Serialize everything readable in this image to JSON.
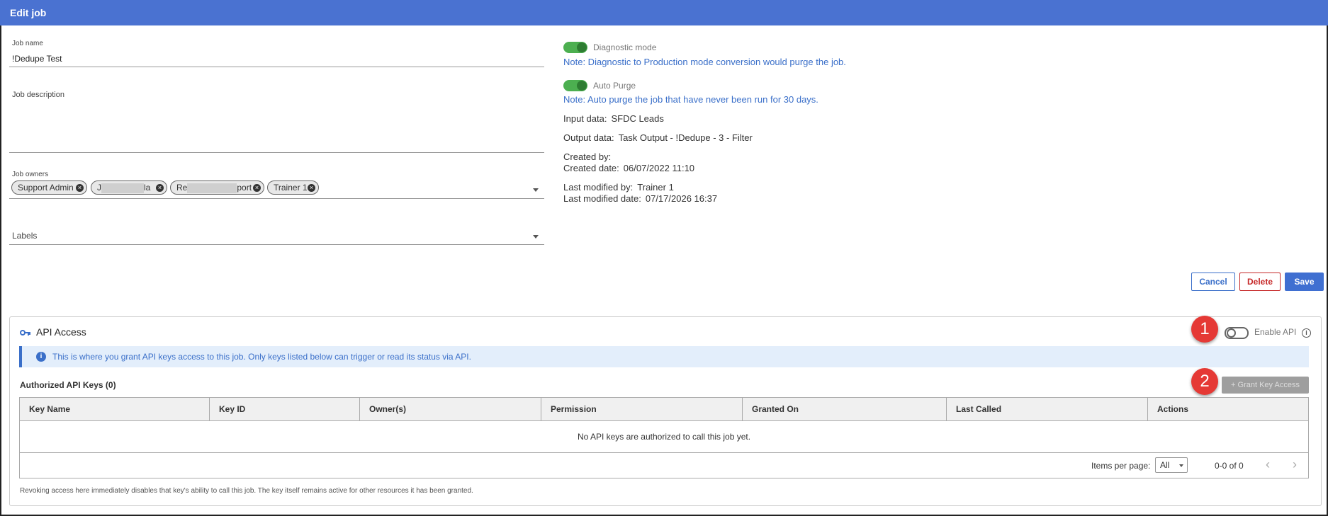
{
  "header": {
    "title": "Edit job"
  },
  "job": {
    "name_label": "Job name",
    "name_value": "!Dedupe Test",
    "description_label": "Job description",
    "owners_label": "Job owners",
    "owners": [
      "Support Admin",
      "J",
      "la",
      "Re",
      "port",
      "Trainer 1"
    ],
    "labels_label": "Labels"
  },
  "diagnostic": {
    "label": "Diagnostic mode",
    "enabled": true,
    "note": "Note: Diagnostic to Production mode conversion would purge the job."
  },
  "auto_purge": {
    "label": "Auto Purge",
    "enabled": true,
    "note": "Note: Auto purge the job that have never been run for 30 days."
  },
  "details": {
    "input_label": "Input data:",
    "input_value": "SFDC Leads",
    "output_label": "Output data:",
    "output_value": "Task Output - !Dedupe - 3 - Filter",
    "created_by_label": "Created by:",
    "created_by_value": "",
    "created_date_label": "Created date:",
    "created_date_value": "06/07/2022 11:10",
    "modified_by_label": "Last modified by:",
    "modified_by_value": "Trainer 1",
    "modified_date_label": "Last modified date:",
    "modified_date_value": "07/17/2026 16:37"
  },
  "actions": {
    "cancel": "Cancel",
    "delete": "Delete",
    "save": "Save"
  },
  "api": {
    "title": "API Access",
    "enable_label": "Enable API",
    "enabled": false,
    "banner": "This is where you grant API keys access to this job. Only keys listed below can trigger or read its status via API.",
    "authorized_label": "Authorized API Keys (0)",
    "grant_button": "+ Grant Key Access",
    "columns": [
      "Key Name",
      "Key ID",
      "Owner(s)",
      "Permission",
      "Granted On",
      "Last Called",
      "Actions"
    ],
    "empty_message": "No API keys are authorized to call this job yet.",
    "items_per_page_label": "Items per page:",
    "items_per_page_value": "All",
    "range": "0-0 of 0",
    "footer_note": "Revoking access here immediately disables that key's ability to call this job. The key itself remains active for other resources it has been granted."
  },
  "markers": [
    "1",
    "2"
  ],
  "colors": {
    "header": "#4a72d1",
    "accent": "#3a6fc9",
    "danger": "#c62828",
    "toggle_on": "#4caf50",
    "marker": "#e53935"
  }
}
